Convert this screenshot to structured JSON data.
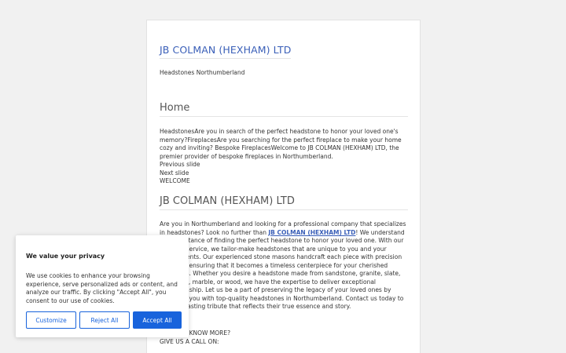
{
  "site": {
    "title": "JB COLMAN (HEXHAM) LTD",
    "tagline": "Headstones Northumberland"
  },
  "home": {
    "heading": "Home",
    "slide_text": "HeadstonesAre you in search of the perfect headstone to honor your loved one's memory?FireplacesAre you searching for the perfect fireplace to make your home cozy and inviting? Bespoke FireplacesWelcome to JB COLMAN (HEXHAM) LTD, the premier provider of bespoke fireplaces in Northumberland.",
    "prev_slide": "Previous slide",
    "next_slide": "Next slide",
    "welcome": "WELCOME"
  },
  "company": {
    "heading": "JB COLMAN (HEXHAM) LTD",
    "para_before": "Are you in Northumberland and looking for a professional company that specializes in headstones? Look no further than ",
    "link": "JB COLMAN (HEXHAM) LTD",
    "para_after": "! We understand the importance of finding the perfect headstone to honor your loved one. With our bespoke service, we tailor-make headstones that are unique to you and your requirements. Our experienced stone masons handcraft each piece with precision and care, ensuring that it becomes a timeless centerpiece for your cherished memories. Whether you desire a headstone made from sandstone, granite, slate, limestone, marble, or wood, we have the expertise to deliver exceptional craftsmanship. Let us be a part of preserving the legacy of your loved ones by providing you with top-quality headstones in Northumberland. Contact us today to create a lasting tribute that reflects their true essence and story."
  },
  "footer": {
    "want_know": "WANT TO KNOW MORE?",
    "call": "GIVE US A CALL ON:"
  },
  "cookie": {
    "title": "We value your privacy",
    "text": "We use cookies to enhance your browsing experience, serve personalized ads or content, and analyze our traffic. By clicking \"Accept All\", you consent to our use of cookies.",
    "customize": "Customize",
    "reject": "Reject All",
    "accept": "Accept All"
  },
  "colors": {
    "link": "#3a5fb8",
    "accept_button": "#1863dc"
  }
}
